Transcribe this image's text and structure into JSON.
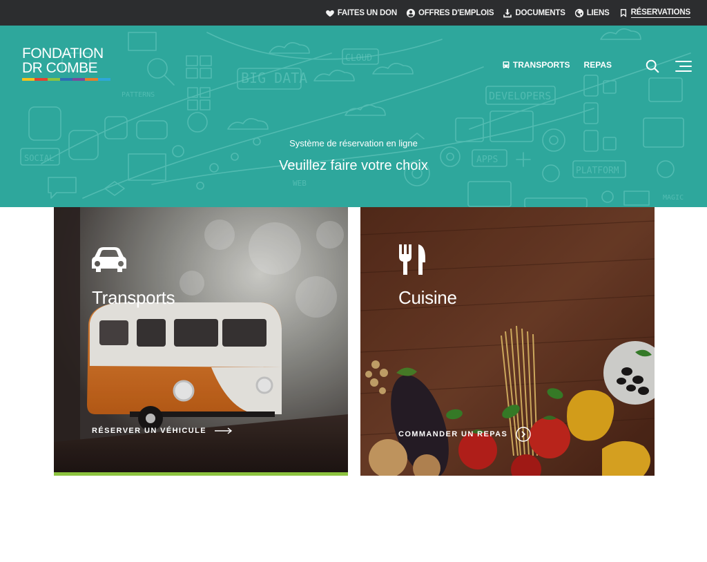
{
  "utility": {
    "items": [
      {
        "label": "FAITES UN DON",
        "icon": "heart-icon"
      },
      {
        "label": "OFFRES D'EMPLOIS",
        "icon": "user-circle-icon"
      },
      {
        "label": "DOCUMENTS",
        "icon": "download-icon"
      },
      {
        "label": "LIENS",
        "icon": "globe-icon"
      },
      {
        "label": "RÉSERVATIONS",
        "icon": "bookmark-icon",
        "active": true
      }
    ]
  },
  "logo": {
    "line1": "FONDATION",
    "line2": "DR COMBE",
    "bar_colors": [
      "#f6c21b",
      "#e2432f",
      "#8cc33f",
      "#2e6db4",
      "#7a4a9c",
      "#e77e2b",
      "#2ea7d9"
    ]
  },
  "nav": {
    "transports": "TRANSPORTS",
    "repas": "REPAS"
  },
  "hero": {
    "subtitle": "Système de réservation en ligne",
    "title": "Veuillez faire votre choix",
    "doodle_words": [
      "CLOUD",
      "BIG DATA",
      "DEVELOPERS",
      "SOCIAL",
      "APPS",
      "PLATFORM",
      "PATTERNS",
      "WEB",
      "MAGIC"
    ]
  },
  "cards": {
    "transports": {
      "title": "Transports",
      "link": "RÉSERVER UN VÉHICULE",
      "icon": "car-icon"
    },
    "cuisine": {
      "title": "Cuisine",
      "link": "COMMANDER UN REPAS",
      "icon": "fork-knife-icon"
    }
  },
  "colors": {
    "utility_bg": "#2c2d2f",
    "hero_bg": "#2ea79c",
    "accent_green": "#8cc33f"
  }
}
